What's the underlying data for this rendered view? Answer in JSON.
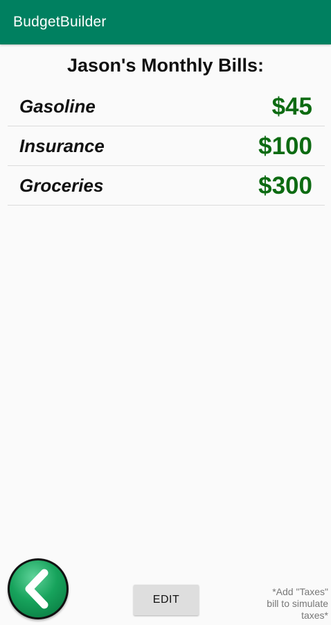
{
  "app_bar": {
    "title": "BudgetBuilder",
    "color": "#008060"
  },
  "page_title": "Jason's Monthly Bills:",
  "bills": [
    {
      "name": "Gasoline",
      "amount": "$45"
    },
    {
      "name": "Insurance",
      "amount": "$100"
    },
    {
      "name": "Groceries",
      "amount": "$300"
    }
  ],
  "amount_color": "#0d6b12",
  "back_button": {
    "icon": "chevron-left-icon"
  },
  "edit_button": {
    "label": "EDIT"
  },
  "hint": {
    "line1": "*Add \"Taxes\"",
    "line2": "bill to simulate",
    "line3": "taxes*"
  }
}
